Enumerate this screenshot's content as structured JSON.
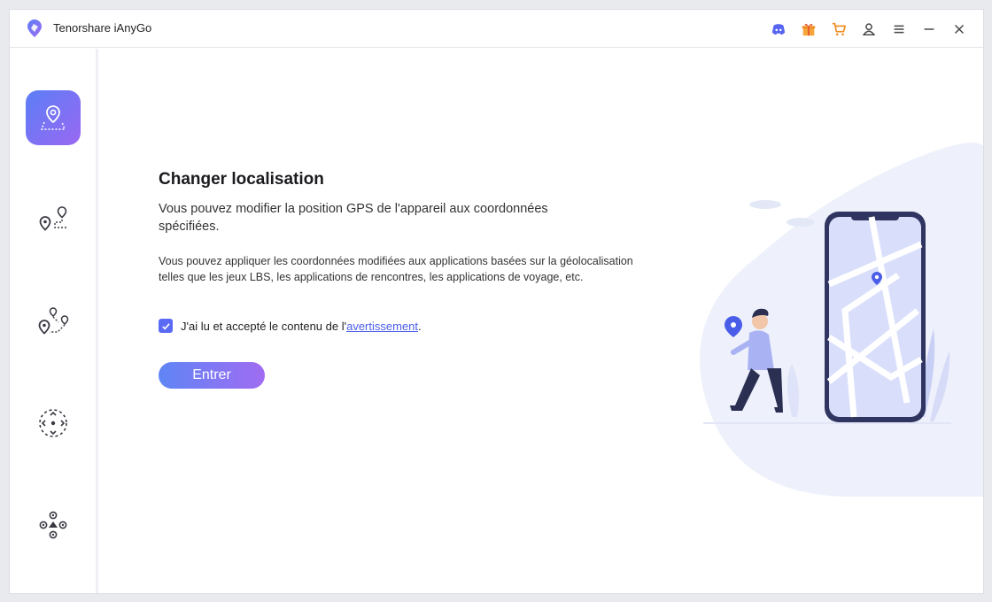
{
  "titlebar": {
    "app_name": "Tenorshare iAnyGo",
    "icons": [
      "discord-icon",
      "gift-icon",
      "cart-icon",
      "user-icon",
      "menu-icon",
      "minimize-icon",
      "close-icon"
    ]
  },
  "sidebar": {
    "items": [
      {
        "icon": "change-location-icon",
        "active": true
      },
      {
        "icon": "single-spot-route-icon",
        "active": false
      },
      {
        "icon": "multi-spot-route-icon",
        "active": false
      },
      {
        "icon": "joystick-icon",
        "active": false
      },
      {
        "icon": "gamepad-icon",
        "active": false
      }
    ]
  },
  "main": {
    "title": "Changer localisation",
    "description": "Vous pouvez modifier la position GPS de l'appareil aux coordonnées spécifiées.",
    "note": "Vous pouvez appliquer les coordonnées modifiées aux applications basées sur la géolocalisation telles que les jeux LBS, les applications de rencontres, les applications de voyage, etc.",
    "agreement": {
      "checked": true,
      "text_before": "J'ai lu et accepté le contenu de l'",
      "link_text": "avertissement",
      "text_after": "."
    },
    "enter_label": "Entrer"
  },
  "colors": {
    "accent": "#5b6af5",
    "gradient_start": "#5f85f5",
    "gradient_end": "#a06cf2",
    "icon_dark": "#3a3a44"
  }
}
